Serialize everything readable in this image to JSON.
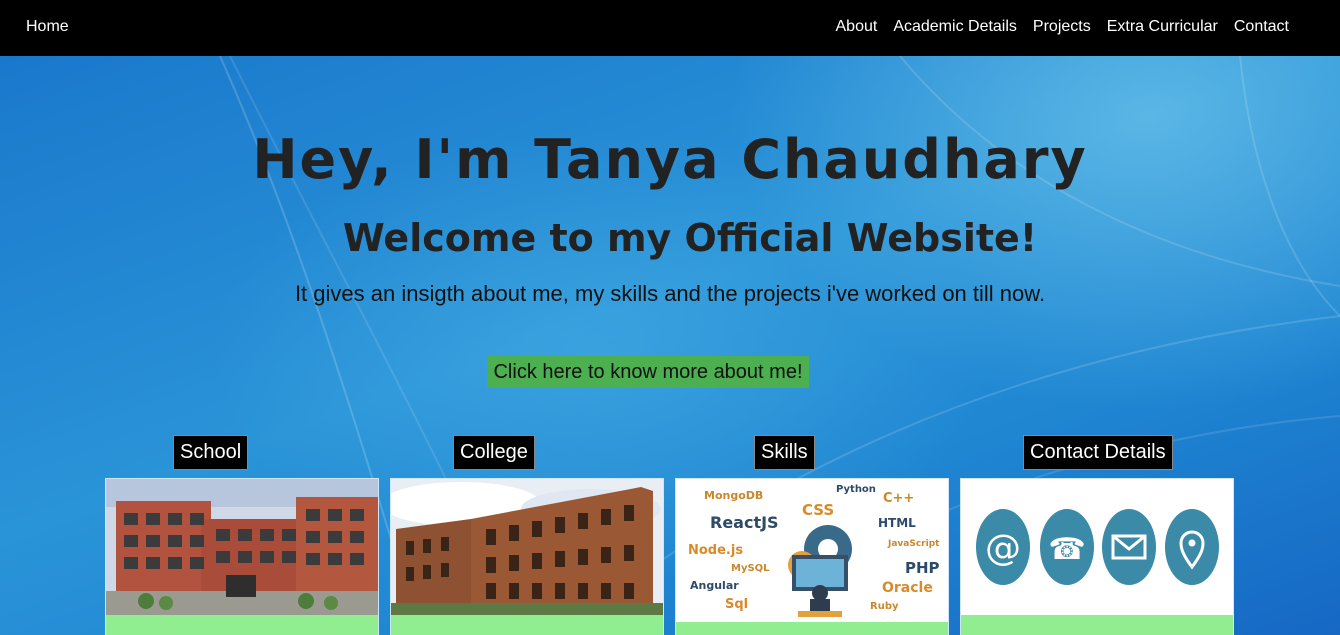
{
  "nav": {
    "home": "Home",
    "links": [
      "About",
      "Academic Details",
      "Projects",
      "Extra Curricular",
      "Contact"
    ]
  },
  "hero": {
    "title": "Hey, I'm Tanya Chaudhary",
    "subtitle": "Welcome to my Official Website!",
    "tagline": "It gives an insigth about me, my skills and the projects i've worked on till now.",
    "cta": "Click here to know more about me!"
  },
  "cards": [
    {
      "label": "School",
      "icon": "school-building-photo"
    },
    {
      "label": "College",
      "icon": "college-building-photo"
    },
    {
      "label": "Skills",
      "icon": "skills-collage"
    },
    {
      "label": "Contact Details",
      "icon": "contact-icons"
    }
  ],
  "skills": [
    "MongoDB",
    "Python",
    "C++",
    "CSS",
    "ReactJS",
    "HTML",
    "JavaScript",
    "Node.js",
    "MySQL",
    "PHP",
    "Angular",
    "Oracle",
    "Sql",
    "Ruby"
  ],
  "contact_icons": [
    "at-sign-icon",
    "phone-icon",
    "mail-icon",
    "location-pin-icon"
  ],
  "colors": {
    "navbar": "#000000",
    "background": "#1d7fcf",
    "cta": "#4caf50",
    "card_base": "#90ee90",
    "contact_icon": "#3b8aa8"
  }
}
